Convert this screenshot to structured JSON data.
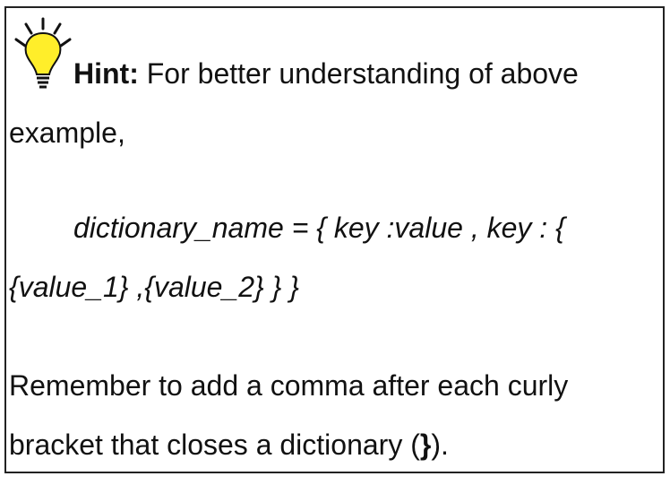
{
  "hint": {
    "icon": "lightbulb-icon",
    "bulb_color": "#ffee2a",
    "label": "Hint:",
    "intro_line1": " For better understanding of above",
    "intro_line2": "example,",
    "code_line1": "dictionary_name = { key :value , key : {",
    "code_line2": "{value_1} ,{value_2} } }",
    "remember_line1": "Remember to add a comma after each curly",
    "remember_line2_prefix": "bracket that closes a dictionary (",
    "remember_bracket": "}",
    "remember_line2_suffix": ")."
  }
}
